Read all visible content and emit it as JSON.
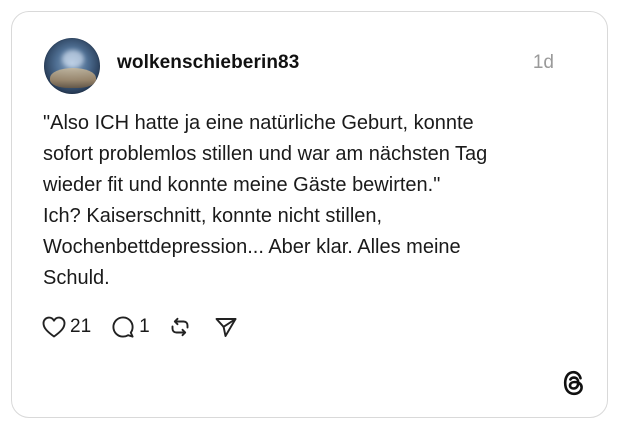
{
  "post": {
    "username": "wolkenschieberin83",
    "time": "1d",
    "text_lines": [
      "\"Also ICH hatte ja eine natürliche Geburt, konnte",
      "sofort problemlos stillen und war am nächsten Tag",
      "wieder fit und konnte meine Gäste bewirten.\"",
      "Ich? Kaiserschnitt, konnte nicht stillen,",
      "Wochenbettdepression... Aber klar. Alles meine",
      "Schuld."
    ],
    "likes": "21",
    "replies": "1"
  },
  "icons": {
    "like": "heart-icon",
    "reply": "speech-bubble-icon",
    "repost": "repost-arrows-icon",
    "share": "paper-plane-icon",
    "brand": "threads-logo-icon"
  },
  "colors": {
    "text": "#111111",
    "muted": "#9a9a9a",
    "border": "#d9d9d9"
  }
}
